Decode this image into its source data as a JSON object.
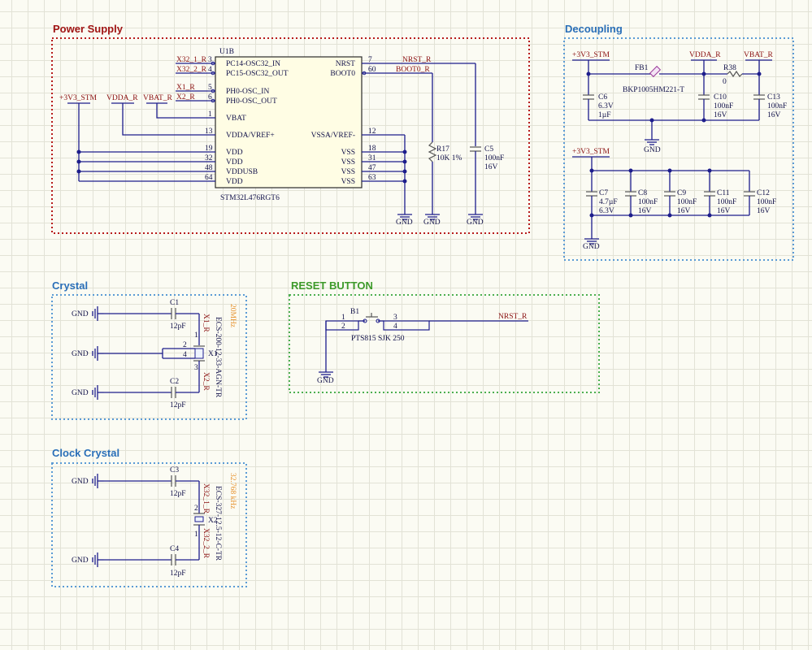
{
  "groups": {
    "power": "Power Supply",
    "decoupling": "Decoupling",
    "crystal": "Crystal",
    "reset": "RESET BUTTON",
    "clock": "Clock Crystal"
  },
  "colors": {
    "power_border": "#b71c1c",
    "decoupling_border": "#5b9bd5",
    "reset_border": "#4caf50",
    "header_red": "#a01414",
    "header_blue": "#2a6fb8",
    "header_green": "#3d9a2a",
    "net_label": "#8a0f0f",
    "wire": "#1d1d8c"
  },
  "ic": {
    "designator": "U1B",
    "part": "STM32L476RGT6",
    "left_pins": [
      {
        "num": "3",
        "name": "PC14-OSC32_IN"
      },
      {
        "num": "4",
        "name": "PC15-OSC32_OUT"
      },
      {
        "num": "5",
        "name": "PH0-OSC_IN"
      },
      {
        "num": "6",
        "name": "PH0-OSC_OUT"
      },
      {
        "num": "1",
        "name": "VBAT"
      },
      {
        "num": "13",
        "name": "VDDA/VREF+"
      },
      {
        "num": "19",
        "name": "VDD"
      },
      {
        "num": "32",
        "name": "VDD"
      },
      {
        "num": "48",
        "name": "VDDUSB"
      },
      {
        "num": "64",
        "name": "VDD"
      }
    ],
    "right_pins": [
      {
        "num": "7",
        "name": "NRST"
      },
      {
        "num": "60",
        "name": "BOOT0"
      },
      {
        "num": "12",
        "name": "VSSA/VREF-"
      },
      {
        "num": "18",
        "name": "VSS"
      },
      {
        "num": "31",
        "name": "VSS"
      },
      {
        "num": "47",
        "name": "VSS"
      },
      {
        "num": "63",
        "name": "VSS"
      }
    ]
  },
  "nets": {
    "x32_1": "X32_1_R",
    "x32_2": "X32_2_R",
    "x1": "X1_R",
    "x2": "X2_R",
    "v3": "+3V3_STM",
    "vdda": "VDDA_R",
    "vbat": "VBAT_R",
    "nrst": "NRST_R",
    "boot0": "BOOT0_R",
    "gnd": "GND"
  },
  "parts": {
    "r17": {
      "des": "R17",
      "val": "10K 1%"
    },
    "c5": {
      "des": "C5",
      "val": "100nF",
      "volt": "16V"
    },
    "fb1": {
      "des": "FB1",
      "val": "BKP1005HM221-T"
    },
    "r38": {
      "des": "R38",
      "val": "0"
    },
    "c6": {
      "des": "C6",
      "volt": "6.3V",
      "val": "1µF"
    },
    "c10": {
      "des": "C10",
      "val": "100nF",
      "volt": "16V"
    },
    "c13": {
      "des": "C13",
      "val": "100nF",
      "volt": "16V"
    },
    "c7": {
      "des": "C7",
      "val": "4.7µF",
      "volt": "6.3V"
    },
    "c8": {
      "des": "C8",
      "val": "100nF",
      "volt": "16V"
    },
    "c9": {
      "des": "C9",
      "val": "100nF",
      "volt": "16V"
    },
    "c11": {
      "des": "C11",
      "val": "100nF",
      "volt": "16V"
    },
    "c12": {
      "des": "C12",
      "val": "100nF",
      "volt": "16V"
    },
    "c1": {
      "des": "C1",
      "val": "12pF"
    },
    "c2": {
      "des": "C2",
      "val": "12pF"
    },
    "c3": {
      "des": "C3",
      "val": "12pF"
    },
    "c4": {
      "des": "C4",
      "val": "12pF"
    },
    "x1": {
      "des": "X1",
      "part": "ECS-200-12-33-AGN-TR",
      "freq": "20MHz",
      "p1": "1",
      "p2": "2",
      "p3": "3",
      "p4": "4"
    },
    "x2": {
      "des": "X2",
      "part": "ECS-327-12.5-12-C-TR",
      "freq": "32.768 kHz",
      "p1": "1",
      "p2": "2"
    },
    "b1": {
      "des": "B1",
      "part": "PTS815 SJK 250",
      "p1": "1",
      "p2": "2",
      "p3": "3",
      "p4": "4"
    }
  }
}
